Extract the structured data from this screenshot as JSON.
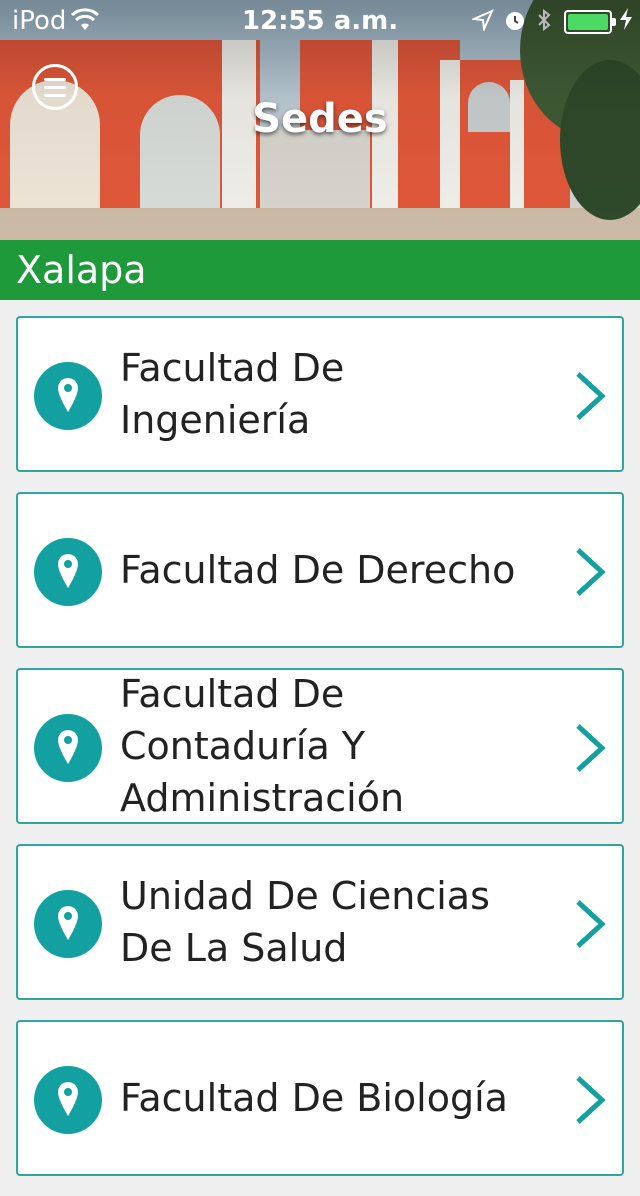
{
  "status_bar": {
    "carrier": "iPod",
    "time": "12:55 a.m.",
    "wifi_icon": "wifi-icon",
    "location_icon": "location-arrow-icon",
    "alarm_icon": "alarm-icon",
    "bluetooth_icon": "bluetooth-icon",
    "battery_level": 1.0,
    "charging_icon": "bolt-icon",
    "battery_color": "#4cd964"
  },
  "header": {
    "title": "Sedes",
    "menu_icon": "hamburger-menu-icon"
  },
  "section": {
    "title": "Xalapa",
    "color": "#1e9a3b"
  },
  "accent_color": "#13a0a0",
  "locations": [
    {
      "label": "Facultad De Ingeniería"
    },
    {
      "label": "Facultad De Derecho"
    },
    {
      "label": "Facultad De Contaduría Y Administración"
    },
    {
      "label": "Unidad De Ciencias De La Salud"
    },
    {
      "label": "Facultad De Biología"
    }
  ]
}
